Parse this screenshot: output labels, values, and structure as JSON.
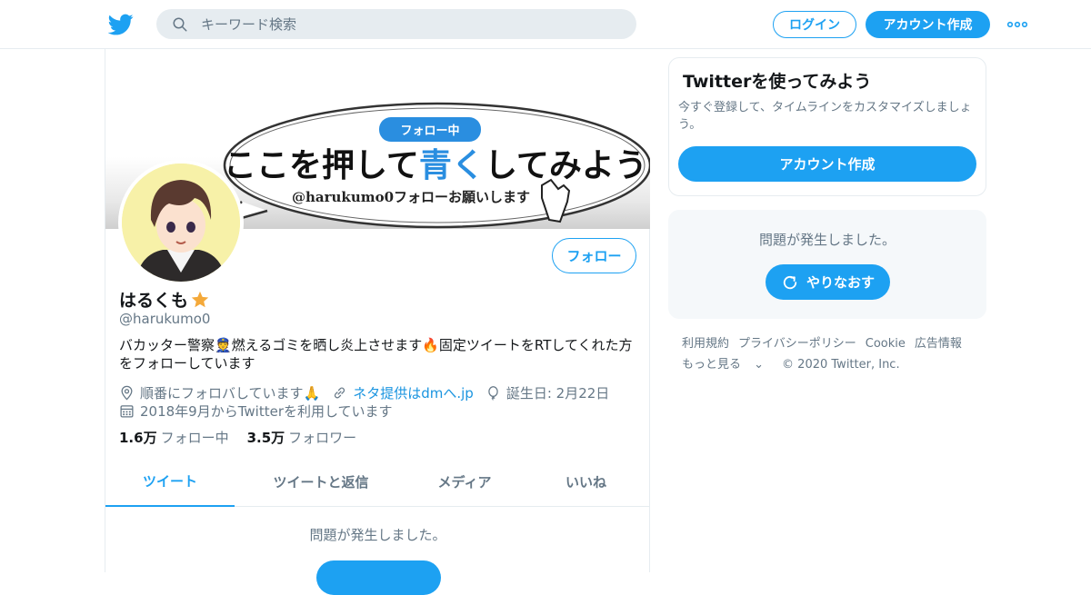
{
  "header": {
    "search_placeholder": "キーワード検索",
    "login_label": "ログイン",
    "signup_label": "アカウント作成"
  },
  "banner": {
    "badge": "フォロー中",
    "headline_a": "ここを押して",
    "headline_b": "青く",
    "headline_c": "してみよう",
    "subline": "@harukumo0フォローお願いします"
  },
  "profile": {
    "name": "はるくも",
    "handle": "@harukumo0",
    "follow_label": "フォロー",
    "bio": "バカッター警察👮燃えるゴミを晒し炎上させます🔥固定ツイートをRTしてくれた方をフォローしています",
    "location": "順番にフォロバしています🙏",
    "url_text": "ネタ提供はdmへ.jp",
    "birthday": "誕生日: 2月22日",
    "joined": "2018年9月からTwitterを利用しています",
    "following_count": "1.6万",
    "following_label": "フォロー中",
    "followers_count": "3.5万",
    "followers_label": "フォロワー"
  },
  "tabs": [
    {
      "label": "ツイート"
    },
    {
      "label": "ツイートと返信"
    },
    {
      "label": "メディア"
    },
    {
      "label": "いいね"
    }
  ],
  "main_error": {
    "message": "問題が発生しました。"
  },
  "sidebar": {
    "signup_title": "Twitterを使ってみよう",
    "signup_text": "今すぐ登録して、タイムラインをカスタマイズしましょう。",
    "signup_button": "アカウント作成",
    "error_message": "問題が発生しました。",
    "retry_label": "やりなおす"
  },
  "footer": {
    "links": [
      "利用規約",
      "プライバシーポリシー",
      "Cookie",
      "広告情報"
    ],
    "more": "もっと見る",
    "copyright": "© 2020 Twitter, Inc."
  },
  "colors": {
    "accent": "#1da1f2",
    "muted_text": "#657786",
    "border": "#e6ecf0",
    "banner_blue": "#2a8ee0"
  }
}
